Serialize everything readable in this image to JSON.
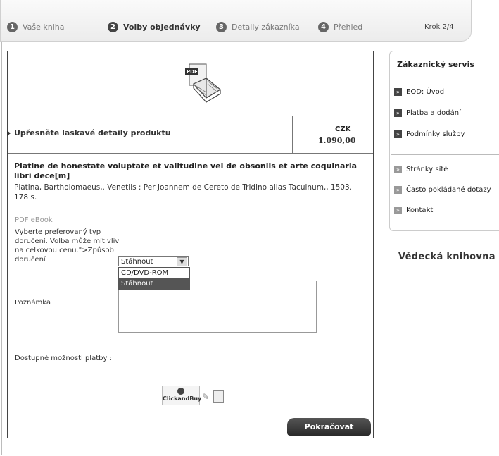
{
  "steps": [
    {
      "num": "1",
      "label": "Vaše kniha"
    },
    {
      "num": "2",
      "label": "Volby objednávky"
    },
    {
      "num": "3",
      "label": "Detaily zákazníka"
    },
    {
      "num": "4",
      "label": "Přehled"
    }
  ],
  "step_counter": "Krok 2/4",
  "product": {
    "bar_label": "Upřesněte laskavé detaily produktu",
    "currency": "CZK",
    "price": "1.090,00"
  },
  "book": {
    "title": "Platine de honestate voluptate et valitudine vel de obsoniis et arte coquinaria libri dece[m]",
    "meta": "Platina, Bartholomaeus,. Venetiis : Per Joannem de Cereto de Tridino alias Tacuinum,, 1503. 178 s."
  },
  "delivery": {
    "format_label": "PDF eBook",
    "choose_text": "Vyberte preferovaný typ doručení. Volba může mít vliv na celkovou cenu.\">Způsob doručení",
    "selected": "Stáhnout",
    "options": [
      "CD/DVD-ROM",
      "Stáhnout"
    ],
    "note_label": "Poznámka",
    "note_value": ""
  },
  "payment": {
    "label": "Dostupné možnosti platby :",
    "logo_text": "ClickandBuy"
  },
  "continue_label": "Pokračovat",
  "sidebar": {
    "title": "Zákaznický servis",
    "items": [
      "EOD: Úvod",
      "Platba a dodání",
      "Podmínky služby"
    ],
    "items2": [
      "Stránky sítě",
      "Často pokládané dotazy",
      "Kontakt"
    ]
  },
  "library_title": "Vědecká knihovna v"
}
